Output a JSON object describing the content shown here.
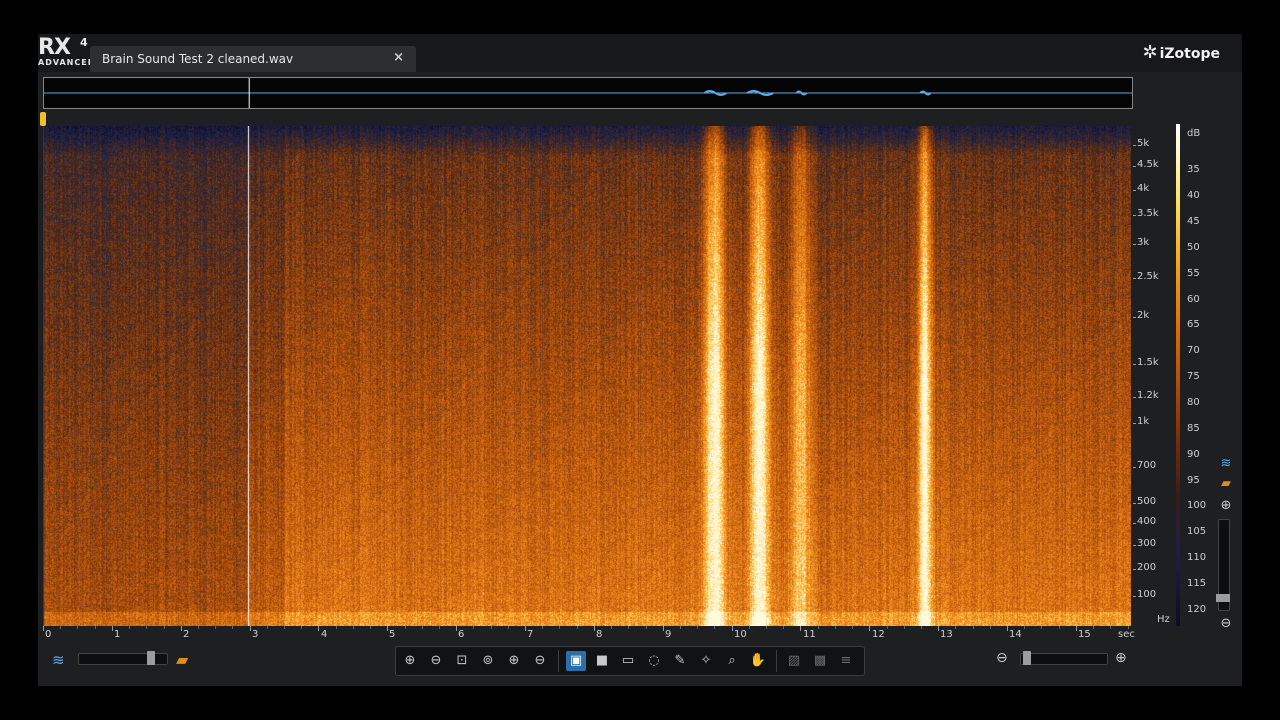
{
  "app": {
    "logo": {
      "main": "RX",
      "sup": "4",
      "edition": "ADVANCED"
    },
    "brand": "iZotope",
    "tab": {
      "label": "Brain Sound Test 2 cleaned.wav",
      "close_glyph": "×"
    }
  },
  "frequency_axis": {
    "labels": [
      "5k",
      "4.5k",
      "4k",
      "3.5k",
      "3k",
      "2.5k",
      "2k",
      "1.5k",
      "1.2k",
      "1k",
      "700",
      "500",
      "400",
      "300",
      "200",
      "100"
    ],
    "unit": "Hz"
  },
  "db_scale": {
    "unit": "dB",
    "labels": [
      "35",
      "40",
      "45",
      "50",
      "55",
      "60",
      "65",
      "70",
      "75",
      "80",
      "85",
      "90",
      "95",
      "100",
      "105",
      "110",
      "115",
      "120"
    ]
  },
  "time_axis": {
    "labels": [
      "0",
      "1",
      "2",
      "3",
      "4",
      "5",
      "6",
      "7",
      "8",
      "9",
      "10",
      "11",
      "12",
      "13",
      "14",
      "15"
    ],
    "unit": "sec"
  },
  "view": {
    "duration_sec": 15.8,
    "cursor_sec": 2.98,
    "bursts_sec": [
      9.75,
      10.4,
      11.0,
      12.8
    ],
    "waveform_slider": 0.85,
    "zoom_slider": 0.0
  },
  "toolbar": {
    "tools": [
      {
        "name": "zoom-in-icon",
        "glyph": "⊕"
      },
      {
        "name": "zoom-out-icon",
        "glyph": "⊖"
      },
      {
        "name": "zoom-selection-icon",
        "glyph": "⊡"
      },
      {
        "name": "zoom-full-icon",
        "glyph": "⊚"
      },
      {
        "name": "zoom-time-in-icon",
        "glyph": "⊕"
      },
      {
        "name": "zoom-time-out-icon",
        "glyph": "⊖"
      },
      {
        "name": "time-selection-icon",
        "glyph": "▣"
      },
      {
        "name": "frequency-selection-icon",
        "glyph": "■"
      },
      {
        "name": "time-frequency-selection-icon",
        "glyph": "▭"
      },
      {
        "name": "lasso-icon",
        "glyph": "◌"
      },
      {
        "name": "brush-icon",
        "glyph": "✎"
      },
      {
        "name": "magic-wand-icon",
        "glyph": "✧"
      },
      {
        "name": "zoom-tool-icon",
        "glyph": "⌕"
      },
      {
        "name": "hand-icon",
        "glyph": "✋"
      },
      {
        "name": "add-selection-icon",
        "glyph": "▨"
      },
      {
        "name": "subtract-selection-icon",
        "glyph": "▩"
      },
      {
        "name": "harmonics-icon",
        "glyph": "≡"
      }
    ]
  },
  "colors": {
    "accent": "#2a6fa8",
    "cursor": "#f0c02a",
    "waveform": "#5fa8e8"
  }
}
